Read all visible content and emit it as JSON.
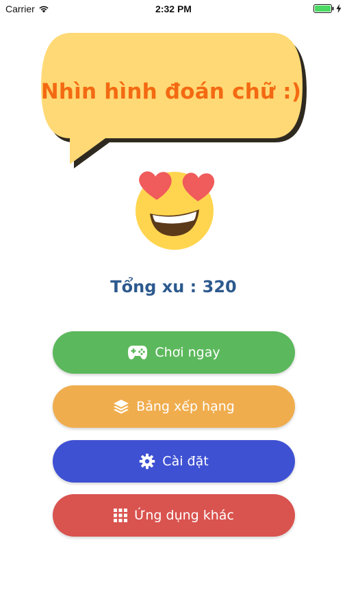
{
  "status_bar": {
    "carrier": "Carrier",
    "time": "2:32 PM"
  },
  "title": "Nhìn hình đoán chữ :)",
  "coins_text": "Tổng xu : 320",
  "menu": {
    "play": {
      "label": "Chơi ngay",
      "icon": "gamepad-icon",
      "color": "#5cb85c"
    },
    "ranking": {
      "label": "Bảng xếp hạng",
      "icon": "layers-icon",
      "color": "#f0ad4e"
    },
    "settings": {
      "label": "Cài đặt",
      "icon": "gear-icon",
      "color": "#3f51d3"
    },
    "other_apps": {
      "label": "Ứng dụng khác",
      "icon": "grid-icon",
      "color": "#d9534f"
    }
  },
  "colors": {
    "title": "#f36a12",
    "bubble": "#ffd975",
    "coins": "#2d5a8e"
  }
}
